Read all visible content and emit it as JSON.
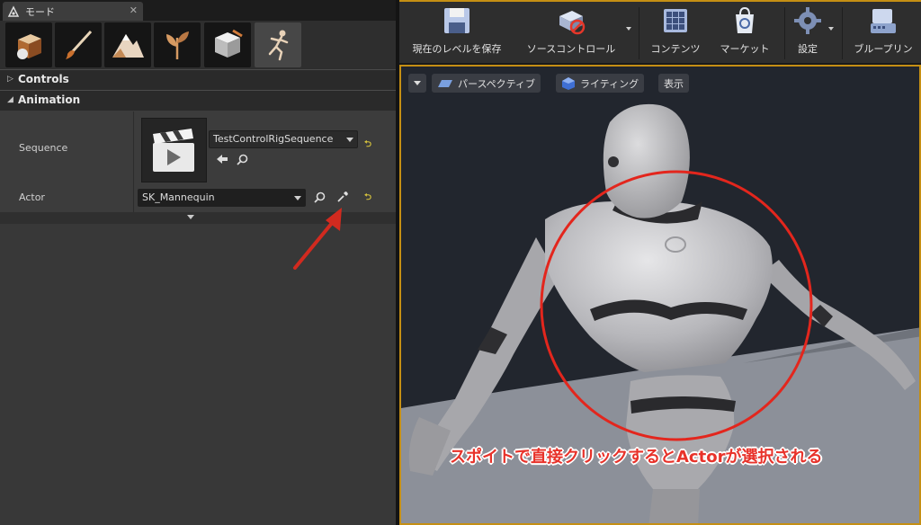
{
  "modes_panel": {
    "tab_title": "モード",
    "tools": [
      {
        "name": "place-icon"
      },
      {
        "name": "paint-icon"
      },
      {
        "name": "landscape-icon"
      },
      {
        "name": "foliage-icon"
      },
      {
        "name": "mesh-paint-icon"
      },
      {
        "name": "animation-icon",
        "active": true
      }
    ],
    "sections": {
      "controls": {
        "title": "Controls"
      },
      "animation": {
        "title": "Animation"
      }
    },
    "properties": {
      "sequence_label": "Sequence",
      "sequence_value": "TestControlRigSequence",
      "actor_label": "Actor",
      "actor_value": "SK_Mannequin"
    }
  },
  "toolbar": {
    "buttons": [
      {
        "label": "現在のレベルを保存",
        "icon": "save-icon"
      },
      {
        "label": "ソースコントロール",
        "icon": "source-control-icon"
      },
      {
        "label": "コンテンツ",
        "icon": "content-icon"
      },
      {
        "label": "マーケット",
        "icon": "marketplace-icon"
      },
      {
        "label": "設定",
        "icon": "settings-icon"
      },
      {
        "label": "ブループリン",
        "icon": "blueprint-icon"
      }
    ]
  },
  "viewport": {
    "perspective_label": "パースペクティブ",
    "lighting_label": "ライティング",
    "show_label": "表示"
  },
  "annotation": {
    "caption": "スポイトで直接クリックするとActorが選択される",
    "color": "#e8322a"
  },
  "colors": {
    "accent_border": "#c58f14",
    "reset_arrow": "#d9c53c"
  }
}
